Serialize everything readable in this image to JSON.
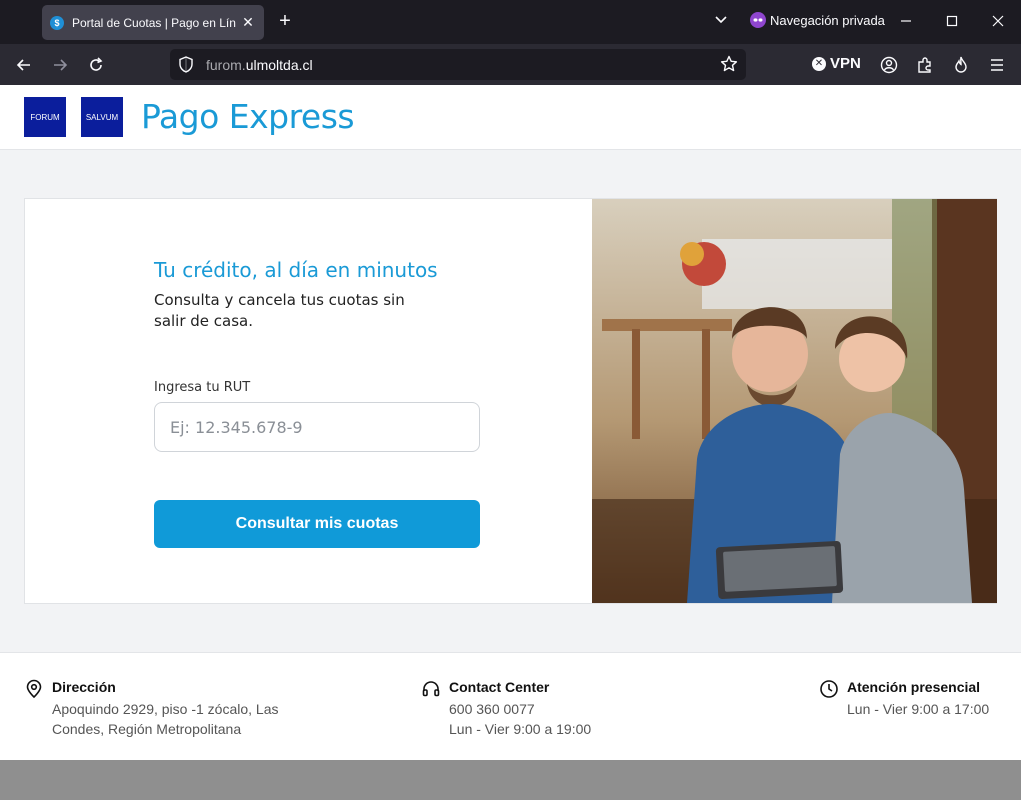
{
  "browser": {
    "tab_title": "Portal de Cuotas | Pago en Línea",
    "private_label": "Navegación privada",
    "url_prefix": "furom.",
    "url_domain": "ulmoltda.cl",
    "vpn_label": "VPN"
  },
  "header": {
    "logo1_text": "FORUM",
    "logo2_text": "SALVUM",
    "title": "Pago Express"
  },
  "form": {
    "headline": "Tu crédito, al día en minutos",
    "subline": "Consulta y cancela tus cuotas sin salir de casa.",
    "rut_label": "Ingresa tu RUT",
    "rut_placeholder": "Ej: 12.345.678-9",
    "rut_value": "",
    "submit_label": "Consultar mis cuotas"
  },
  "footer": {
    "address_title": "Dirección",
    "address_text": "Apoquindo 2929, piso -1 zócalo, Las Condes, Región Metropolitana",
    "contact_title": "Contact Center",
    "contact_phone": "600 360 0077",
    "contact_hours": "Lun - Vier 9:00 a 19:00",
    "presencial_title": "Atención presencial",
    "presencial_hours": "Lun - Vier 9:00 a 17:00"
  },
  "colors": {
    "accent": "#1a9ad6",
    "button": "#109ad8",
    "logo_bg": "#0b1e9c"
  }
}
